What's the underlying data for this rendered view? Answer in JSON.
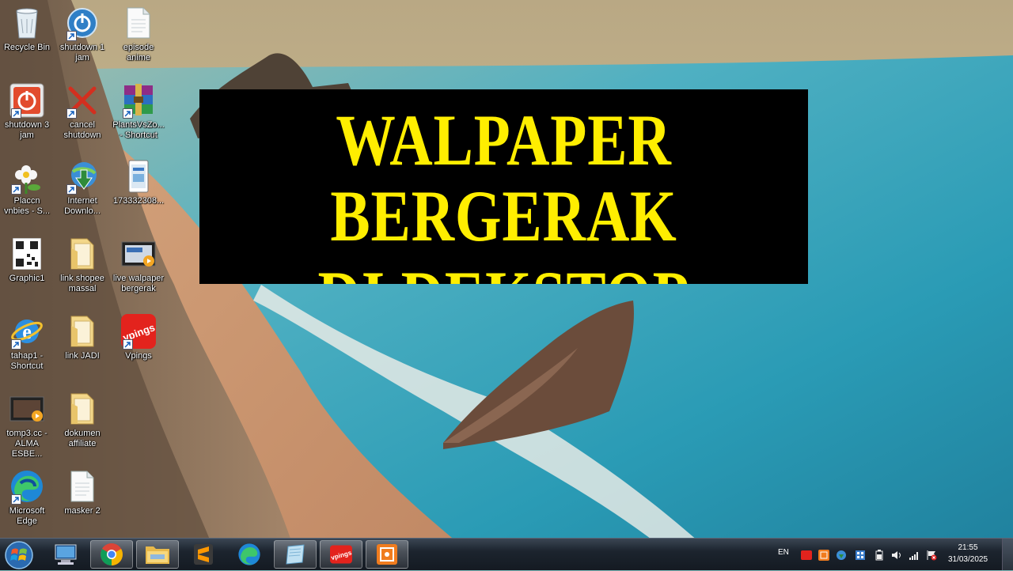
{
  "banner": {
    "line1": "WALPAPER BERGERAK",
    "line2": "DI DEKSTOP",
    "text_color": "#ffee00",
    "background": "#000000"
  },
  "desktop_icons": [
    {
      "label": "Recycle Bin",
      "icon": "recycle-bin-icon",
      "shortcut": false
    },
    {
      "label": "shutdown 1\njam",
      "icon": "power-icon",
      "shortcut": true
    },
    {
      "label": "episode\nanime",
      "icon": "document-icon",
      "shortcut": false
    },
    {
      "label": "shutdown 3\njam",
      "icon": "red-power-icon",
      "shortcut": true
    },
    {
      "label": "cancel\nshutdown",
      "icon": "red-x-icon",
      "shortcut": true
    },
    {
      "label": "PlantsVsZo...\n- Shortcut",
      "icon": "winrar-icon",
      "shortcut": true
    },
    {
      "label": "Placcn\nvnbies - S...",
      "icon": "flower-icon",
      "shortcut": true
    },
    {
      "label": "Internet\nDownlo...",
      "icon": "internet-download-manager-icon",
      "shortcut": true
    },
    {
      "label": "173332308...",
      "icon": "phone-image-icon",
      "shortcut": false
    },
    {
      "label": "Graphic1",
      "icon": "qr-code-icon",
      "shortcut": false
    },
    {
      "label": "link shopee\nmassal",
      "icon": "folder-icon",
      "shortcut": false
    },
    {
      "label": "live walpaper\nbergerak",
      "icon": "video-file-icon",
      "shortcut": false
    },
    {
      "label": "tahap1 -\nShortcut",
      "icon": "internet-explorer-icon",
      "shortcut": true
    },
    {
      "label": "link JADI",
      "icon": "folder-icon",
      "shortcut": false
    },
    {
      "label": "Vpings",
      "icon": "vpings-icon",
      "shortcut": true
    },
    {
      "label": "tomp3.cc -\nALMA ESBE...",
      "icon": "video-file-icon",
      "shortcut": false
    },
    {
      "label": "dokumen\naffiliate",
      "icon": "folder-icon",
      "shortcut": false
    },
    {
      "label": "Microsoft\nEdge",
      "icon": "edge-icon",
      "shortcut": true
    },
    {
      "label": "masker 2",
      "icon": "document-icon",
      "shortcut": false
    }
  ],
  "taskbar": {
    "pinned": [
      {
        "name": "computer",
        "icon": "computer-icon"
      },
      {
        "name": "chrome",
        "icon": "chrome-icon",
        "active": true
      },
      {
        "name": "explorer",
        "icon": "file-explorer-icon",
        "active": true
      },
      {
        "name": "sublime",
        "icon": "sublime-text-icon"
      },
      {
        "name": "edge",
        "icon": "edge-icon"
      },
      {
        "name": "notebook",
        "icon": "notebook-icon",
        "active": true
      },
      {
        "name": "vpings",
        "icon": "vpings-icon",
        "active": true
      },
      {
        "name": "capture",
        "icon": "screen-capture-icon",
        "active": true
      }
    ],
    "language": "EN",
    "time": "21:55",
    "date": "31/03/2025"
  }
}
